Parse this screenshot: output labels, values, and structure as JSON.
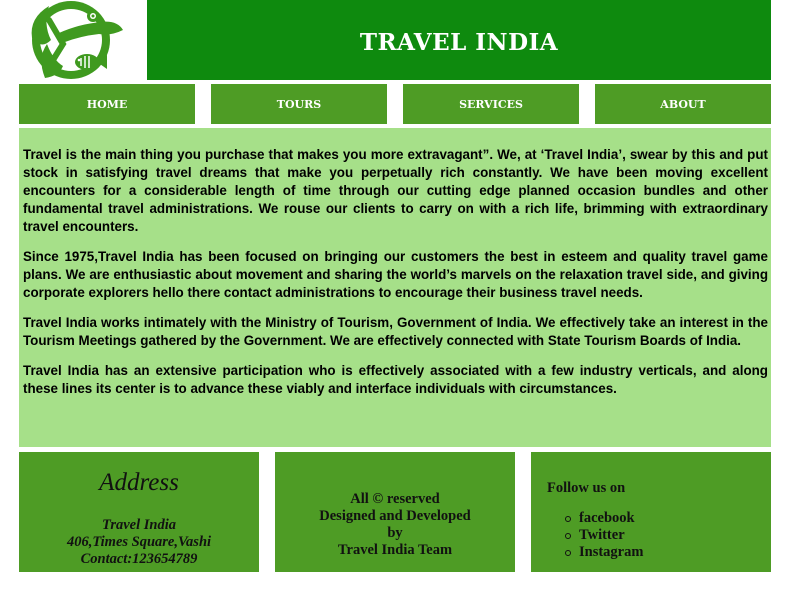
{
  "header": {
    "title": "TRAVEL INDIA",
    "logo_icon": "crocodile-fish-leaf-logo-icon"
  },
  "nav": {
    "items": [
      {
        "label": "HOME"
      },
      {
        "label": "TOURS"
      },
      {
        "label": "SERVICES"
      },
      {
        "label": "ABOUT"
      }
    ]
  },
  "content": {
    "paragraphs": [
      "Travel is the main thing you purchase that makes you more extravagant”. We, at ‘Travel India’, swear by this and put stock in satisfying travel dreams that make you perpetually rich constantly. We have been moving excellent encounters for a considerable length of time through our cutting edge planned occasion bundles and other fundamental travel administrations. We rouse our clients to carry on with a rich life, brimming with extraordinary travel encounters.",
      "Since 1975,Travel India has been focused on bringing our customers the best in esteem and quality travel game plans. We are enthusiastic about movement and sharing the world’s marvels on the relaxation travel side, and giving corporate explorers hello there contact administrations to encourage their business travel needs.",
      "Travel India works intimately with the Ministry of Tourism, Government of India. We effectively take an interest in the Tourism Meetings gathered by the Government. We are effectively connected with State Tourism Boards of India.",
      "Travel India has an extensive participation who is effectively associated with a few industry verticals, and along these lines its center is to advance these viably and interface individuals with circumstances."
    ]
  },
  "footer": {
    "address": {
      "title": "Address",
      "lines": [
        "Travel India",
        "406,Times Square,Vashi",
        "Contact:123654789"
      ]
    },
    "credits": {
      "lines": [
        "All © reserved",
        "Designed and Developed",
        "by",
        "Travel India Team"
      ]
    },
    "social": {
      "title": "Follow us on",
      "links": [
        "facebook",
        "Twitter",
        "Instagram"
      ]
    }
  },
  "colors": {
    "header_green": "#0e8a0e",
    "nav_green": "#4e9c25",
    "content_light_green": "#a6e089",
    "text": "#000000"
  }
}
